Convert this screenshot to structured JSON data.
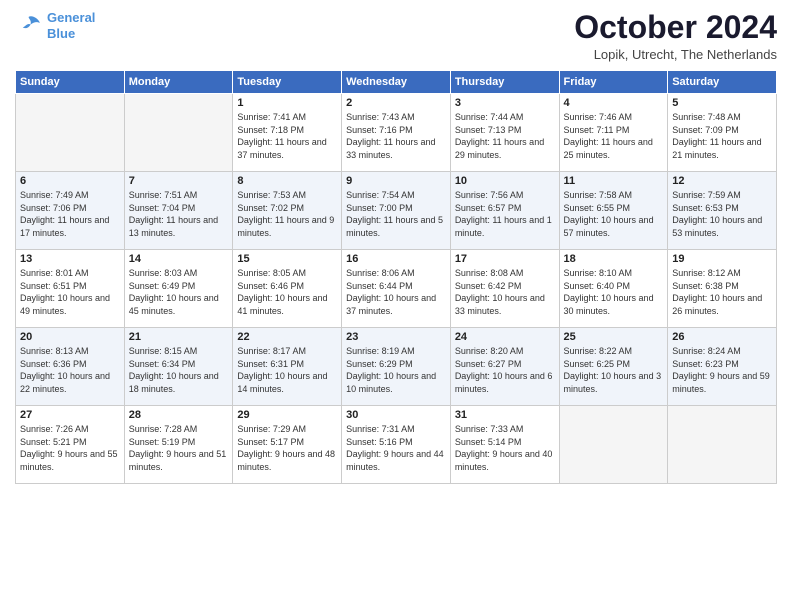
{
  "logo": {
    "line1": "General",
    "line2": "Blue"
  },
  "header": {
    "month": "October 2024",
    "location": "Lopik, Utrecht, The Netherlands"
  },
  "weekdays": [
    "Sunday",
    "Monday",
    "Tuesday",
    "Wednesday",
    "Thursday",
    "Friday",
    "Saturday"
  ],
  "weeks": [
    [
      {
        "day": "",
        "sunrise": "",
        "sunset": "",
        "daylight": ""
      },
      {
        "day": "",
        "sunrise": "",
        "sunset": "",
        "daylight": ""
      },
      {
        "day": "1",
        "sunrise": "Sunrise: 7:41 AM",
        "sunset": "Sunset: 7:18 PM",
        "daylight": "Daylight: 11 hours and 37 minutes."
      },
      {
        "day": "2",
        "sunrise": "Sunrise: 7:43 AM",
        "sunset": "Sunset: 7:16 PM",
        "daylight": "Daylight: 11 hours and 33 minutes."
      },
      {
        "day": "3",
        "sunrise": "Sunrise: 7:44 AM",
        "sunset": "Sunset: 7:13 PM",
        "daylight": "Daylight: 11 hours and 29 minutes."
      },
      {
        "day": "4",
        "sunrise": "Sunrise: 7:46 AM",
        "sunset": "Sunset: 7:11 PM",
        "daylight": "Daylight: 11 hours and 25 minutes."
      },
      {
        "day": "5",
        "sunrise": "Sunrise: 7:48 AM",
        "sunset": "Sunset: 7:09 PM",
        "daylight": "Daylight: 11 hours and 21 minutes."
      }
    ],
    [
      {
        "day": "6",
        "sunrise": "Sunrise: 7:49 AM",
        "sunset": "Sunset: 7:06 PM",
        "daylight": "Daylight: 11 hours and 17 minutes."
      },
      {
        "day": "7",
        "sunrise": "Sunrise: 7:51 AM",
        "sunset": "Sunset: 7:04 PM",
        "daylight": "Daylight: 11 hours and 13 minutes."
      },
      {
        "day": "8",
        "sunrise": "Sunrise: 7:53 AM",
        "sunset": "Sunset: 7:02 PM",
        "daylight": "Daylight: 11 hours and 9 minutes."
      },
      {
        "day": "9",
        "sunrise": "Sunrise: 7:54 AM",
        "sunset": "Sunset: 7:00 PM",
        "daylight": "Daylight: 11 hours and 5 minutes."
      },
      {
        "day": "10",
        "sunrise": "Sunrise: 7:56 AM",
        "sunset": "Sunset: 6:57 PM",
        "daylight": "Daylight: 11 hours and 1 minute."
      },
      {
        "day": "11",
        "sunrise": "Sunrise: 7:58 AM",
        "sunset": "Sunset: 6:55 PM",
        "daylight": "Daylight: 10 hours and 57 minutes."
      },
      {
        "day": "12",
        "sunrise": "Sunrise: 7:59 AM",
        "sunset": "Sunset: 6:53 PM",
        "daylight": "Daylight: 10 hours and 53 minutes."
      }
    ],
    [
      {
        "day": "13",
        "sunrise": "Sunrise: 8:01 AM",
        "sunset": "Sunset: 6:51 PM",
        "daylight": "Daylight: 10 hours and 49 minutes."
      },
      {
        "day": "14",
        "sunrise": "Sunrise: 8:03 AM",
        "sunset": "Sunset: 6:49 PM",
        "daylight": "Daylight: 10 hours and 45 minutes."
      },
      {
        "day": "15",
        "sunrise": "Sunrise: 8:05 AM",
        "sunset": "Sunset: 6:46 PM",
        "daylight": "Daylight: 10 hours and 41 minutes."
      },
      {
        "day": "16",
        "sunrise": "Sunrise: 8:06 AM",
        "sunset": "Sunset: 6:44 PM",
        "daylight": "Daylight: 10 hours and 37 minutes."
      },
      {
        "day": "17",
        "sunrise": "Sunrise: 8:08 AM",
        "sunset": "Sunset: 6:42 PM",
        "daylight": "Daylight: 10 hours and 33 minutes."
      },
      {
        "day": "18",
        "sunrise": "Sunrise: 8:10 AM",
        "sunset": "Sunset: 6:40 PM",
        "daylight": "Daylight: 10 hours and 30 minutes."
      },
      {
        "day": "19",
        "sunrise": "Sunrise: 8:12 AM",
        "sunset": "Sunset: 6:38 PM",
        "daylight": "Daylight: 10 hours and 26 minutes."
      }
    ],
    [
      {
        "day": "20",
        "sunrise": "Sunrise: 8:13 AM",
        "sunset": "Sunset: 6:36 PM",
        "daylight": "Daylight: 10 hours and 22 minutes."
      },
      {
        "day": "21",
        "sunrise": "Sunrise: 8:15 AM",
        "sunset": "Sunset: 6:34 PM",
        "daylight": "Daylight: 10 hours and 18 minutes."
      },
      {
        "day": "22",
        "sunrise": "Sunrise: 8:17 AM",
        "sunset": "Sunset: 6:31 PM",
        "daylight": "Daylight: 10 hours and 14 minutes."
      },
      {
        "day": "23",
        "sunrise": "Sunrise: 8:19 AM",
        "sunset": "Sunset: 6:29 PM",
        "daylight": "Daylight: 10 hours and 10 minutes."
      },
      {
        "day": "24",
        "sunrise": "Sunrise: 8:20 AM",
        "sunset": "Sunset: 6:27 PM",
        "daylight": "Daylight: 10 hours and 6 minutes."
      },
      {
        "day": "25",
        "sunrise": "Sunrise: 8:22 AM",
        "sunset": "Sunset: 6:25 PM",
        "daylight": "Daylight: 10 hours and 3 minutes."
      },
      {
        "day": "26",
        "sunrise": "Sunrise: 8:24 AM",
        "sunset": "Sunset: 6:23 PM",
        "daylight": "Daylight: 9 hours and 59 minutes."
      }
    ],
    [
      {
        "day": "27",
        "sunrise": "Sunrise: 7:26 AM",
        "sunset": "Sunset: 5:21 PM",
        "daylight": "Daylight: 9 hours and 55 minutes."
      },
      {
        "day": "28",
        "sunrise": "Sunrise: 7:28 AM",
        "sunset": "Sunset: 5:19 PM",
        "daylight": "Daylight: 9 hours and 51 minutes."
      },
      {
        "day": "29",
        "sunrise": "Sunrise: 7:29 AM",
        "sunset": "Sunset: 5:17 PM",
        "daylight": "Daylight: 9 hours and 48 minutes."
      },
      {
        "day": "30",
        "sunrise": "Sunrise: 7:31 AM",
        "sunset": "Sunset: 5:16 PM",
        "daylight": "Daylight: 9 hours and 44 minutes."
      },
      {
        "day": "31",
        "sunrise": "Sunrise: 7:33 AM",
        "sunset": "Sunset: 5:14 PM",
        "daylight": "Daylight: 9 hours and 40 minutes."
      },
      {
        "day": "",
        "sunrise": "",
        "sunset": "",
        "daylight": ""
      },
      {
        "day": "",
        "sunrise": "",
        "sunset": "",
        "daylight": ""
      }
    ]
  ]
}
